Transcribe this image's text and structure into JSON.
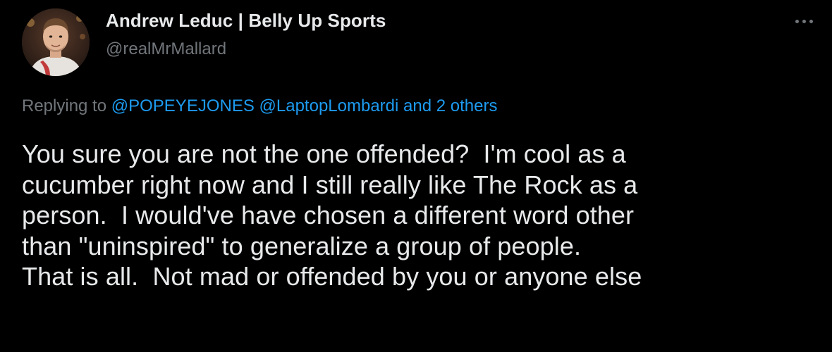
{
  "author": {
    "display_name": "Andrew Leduc | Belly Up Sports",
    "handle": "@realMrMallard"
  },
  "more_icon": "more-horizontal-icon",
  "reply_context": {
    "prefix": "Replying to ",
    "mentions": [
      "@POPEYEJONES",
      "@LaptopLombardi"
    ],
    "others": "and 2 others"
  },
  "tweet": {
    "text": "You sure you are not the one offended?  I'm cool as a\ncucumber right now and I still really like The Rock as a\nperson.  I would've have chosen a different word other\nthan \"uninspired\" to generalize a group of people.\nThat is all.  Not mad or offended by you or anyone else"
  },
  "colors": {
    "background": "#000000",
    "primary_text": "#e7e9ea",
    "secondary_text": "#71767b",
    "link": "#1d9bf0"
  }
}
